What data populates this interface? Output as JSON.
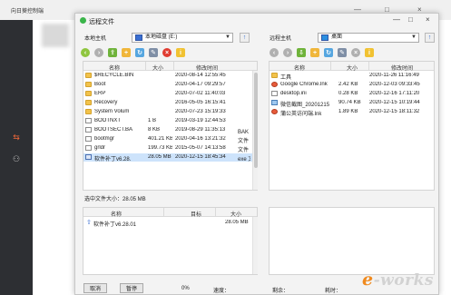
{
  "background_app": {
    "title": "向日葵控制端",
    "window_controls": [
      "—",
      "□",
      "×"
    ]
  },
  "window": {
    "title": "远程文件",
    "controls": [
      "—",
      "□",
      "×"
    ]
  },
  "local": {
    "label": "本地主机",
    "drive": "本地磁盘 (E:)",
    "columns": {
      "name": "名称",
      "size": "大小",
      "modified": "修改时间"
    },
    "files": [
      {
        "name": "$RECYCLE.BIN",
        "size": "",
        "modified": "2020-08-14 12:55:45",
        "icon": "folder"
      },
      {
        "name": "Boot",
        "size": "",
        "modified": "2020-04-17 09:29:57",
        "icon": "folder"
      },
      {
        "name": "ERP",
        "size": "",
        "modified": "2020-07-02 11:40:03",
        "icon": "folder"
      },
      {
        "name": "Recovery",
        "size": "",
        "modified": "2016-05-05 16:15:41",
        "icon": "folder"
      },
      {
        "name": "System Volum",
        "size": "",
        "modified": "2020-07-23 15:19:33",
        "icon": "folder"
      },
      {
        "name": "BOOTNXT",
        "size": "1 B",
        "modified": "2019-03-19 12:44:53",
        "icon": "file"
      },
      {
        "name": "BOOTSECT.BA",
        "size": "8 KB",
        "modified": "2019-08-29 11:35:13",
        "icon": "file",
        "ext": "BAK 文"
      },
      {
        "name": "bootmgr",
        "size": "401.21 KB",
        "modified": "2020-04-16 13:21:32",
        "icon": "file",
        "ext": "文件"
      },
      {
        "name": "grldr",
        "size": "199.73 KB",
        "modified": "2015-05-07 14:13:58",
        "icon": "file",
        "ext": "文件"
      },
      {
        "name": "软件补丁v6.28.",
        "size": "28.05 MB",
        "modified": "2020-12-15 18:45:34",
        "icon": "exe",
        "ext": "exe 文",
        "selected": true
      }
    ],
    "selection_info": "选中文件大小：28.05 MB"
  },
  "remote": {
    "label": "远程主机",
    "drive": "桌面",
    "columns": {
      "name": "名称",
      "size": "大小",
      "modified": "修改时间"
    },
    "files": [
      {
        "name": "工具",
        "size": "",
        "modified": "2020-11-26 11:16:49",
        "icon": "folder"
      },
      {
        "name": "Google Chrome.lnk",
        "size": "2.42 KB",
        "modified": "2020-12-03 09:33:45",
        "icon": "lnk"
      },
      {
        "name": "desktop.ini",
        "size": "0.28 KB",
        "modified": "2020-12-16 17:11:20",
        "icon": "file"
      },
      {
        "name": "微信截图_2020121510",
        "size": "90.74 KB",
        "modified": "2020-12-15 10:19:44",
        "icon": "img"
      },
      {
        "name": "蒲公英访问端.lnk",
        "size": "1.89 KB",
        "modified": "2020-12-15 18:11:32",
        "icon": "lnk"
      }
    ]
  },
  "transfer": {
    "columns": {
      "name": "名称",
      "target": "目标",
      "size": "大小"
    },
    "rows": [
      {
        "name": "软件补丁v6.28.01",
        "target": "",
        "size": "28.05 MB"
      }
    ]
  },
  "bottom": {
    "cancel_label": "取消",
    "pause_label": "暂停",
    "progress_text": "0%",
    "speed_label": "速度：",
    "remaining_label": "剩余：",
    "time_label": "耗时："
  },
  "watermark": {
    "prefix": "e",
    "suffix": "-works"
  },
  "colors": {
    "accent_blue": "#3a6fd2",
    "folder_yellow": "#f2c24a",
    "selected_row": "#cde3fb",
    "sidebar_dark": "#2d2f33",
    "status_green": "#3bb54a"
  }
}
